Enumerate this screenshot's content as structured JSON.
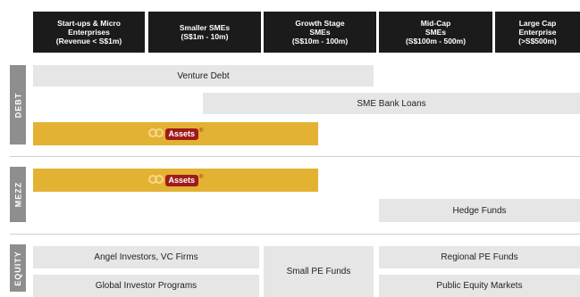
{
  "columns": [
    "Start-ups & Micro\nEnterprises\n(Revenue < S$1m)",
    "Smaller SMEs\n(S$1m - 10m)",
    "Growth Stage\nSMEs\n(S$10m - 100m)",
    "Mid-Cap\nSMEs\n(S$100m - 500m)",
    "Large Cap\nEnterprise\n(>S$500m)"
  ],
  "sections": {
    "debt": "DEBT",
    "mezz": "MEZZ",
    "equity": "EQUITY"
  },
  "debt": {
    "venture_debt": "Venture Debt",
    "sme_bank_loans": "SME Bank Loans",
    "assets_label": "Assets",
    "assets_mark": "®"
  },
  "mezz": {
    "assets_label": "Assets",
    "assets_mark": "®",
    "hedge_funds": "Hedge Funds"
  },
  "equity": {
    "angel_vc": "Angel Investors, VC Firms",
    "global_investor": "Global Investor Programs",
    "small_pe": "Small PE Funds",
    "regional_pe": "Regional PE Funds",
    "public_equity": "Public Equity Markets"
  },
  "colors": {
    "header_bg": "#1b1b1b",
    "bar_bg": "#e6e6e6",
    "gold": "#e4b233",
    "side_label_bg": "#8e8e8e",
    "brand_red": "#9f1b1b"
  }
}
